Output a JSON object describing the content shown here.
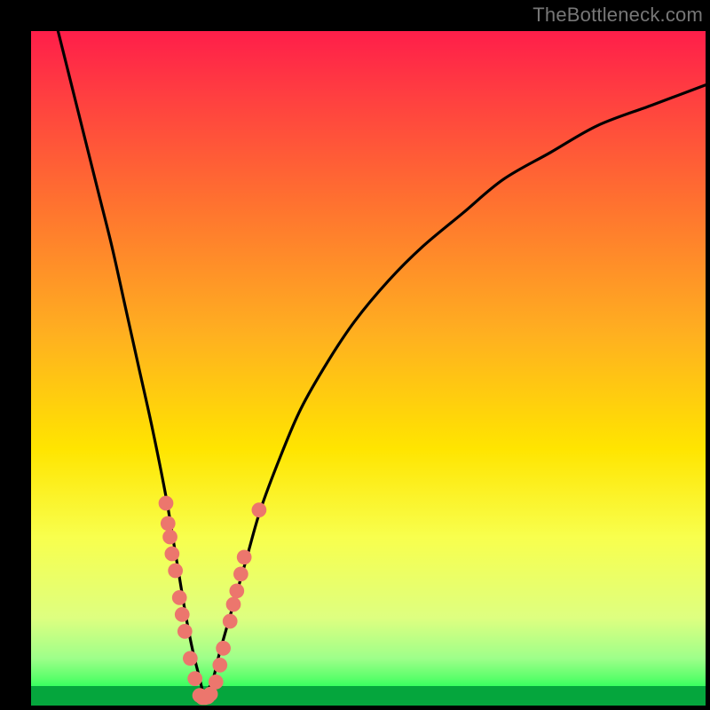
{
  "watermark": "TheBottleneck.com",
  "colors": {
    "frame": "#000000",
    "gradient_top": "#ff1e4a",
    "gradient_bottom": "#00ff44",
    "curve": "#000000",
    "dots": "#ec766d",
    "green_band": "#05a63d"
  },
  "chart_data": {
    "type": "line",
    "title": "",
    "xlabel": "",
    "ylabel": "",
    "xlim": [
      0,
      100
    ],
    "ylim": [
      0,
      100
    ],
    "series": [
      {
        "name": "bottleneck-curve",
        "x": [
          4,
          6,
          8,
          10,
          12,
          14,
          16,
          18,
          20,
          21,
          22,
          23,
          24,
          25,
          25.5,
          26,
          27,
          28,
          30,
          32,
          34,
          37,
          40,
          44,
          48,
          53,
          58,
          64,
          70,
          77,
          84,
          92,
          100
        ],
        "y": [
          100,
          92,
          84,
          76,
          68,
          59,
          50,
          41,
          31,
          25,
          19,
          13,
          8,
          4,
          2,
          2,
          4,
          8,
          15,
          22,
          29,
          37,
          44,
          51,
          57,
          63,
          68,
          73,
          78,
          82,
          86,
          89,
          92
        ]
      }
    ],
    "dots": [
      {
        "x": 20.0,
        "y": 30
      },
      {
        "x": 20.3,
        "y": 27
      },
      {
        "x": 20.6,
        "y": 25
      },
      {
        "x": 20.9,
        "y": 22.5
      },
      {
        "x": 21.4,
        "y": 20
      },
      {
        "x": 22.0,
        "y": 16
      },
      {
        "x": 22.4,
        "y": 13.5
      },
      {
        "x": 22.8,
        "y": 11
      },
      {
        "x": 23.6,
        "y": 7
      },
      {
        "x": 24.3,
        "y": 4
      },
      {
        "x": 25.0,
        "y": 1.5
      },
      {
        "x": 25.4,
        "y": 1.2
      },
      {
        "x": 25.8,
        "y": 1.2
      },
      {
        "x": 26.2,
        "y": 1.3
      },
      {
        "x": 26.6,
        "y": 1.7
      },
      {
        "x": 27.4,
        "y": 3.5
      },
      {
        "x": 28.0,
        "y": 6
      },
      {
        "x": 28.5,
        "y": 8.5
      },
      {
        "x": 29.5,
        "y": 12.5
      },
      {
        "x": 30.0,
        "y": 15
      },
      {
        "x": 30.5,
        "y": 17
      },
      {
        "x": 31.1,
        "y": 19.5
      },
      {
        "x": 31.6,
        "y": 22
      },
      {
        "x": 33.8,
        "y": 29
      }
    ],
    "dot_radius_pct": 1.1
  }
}
